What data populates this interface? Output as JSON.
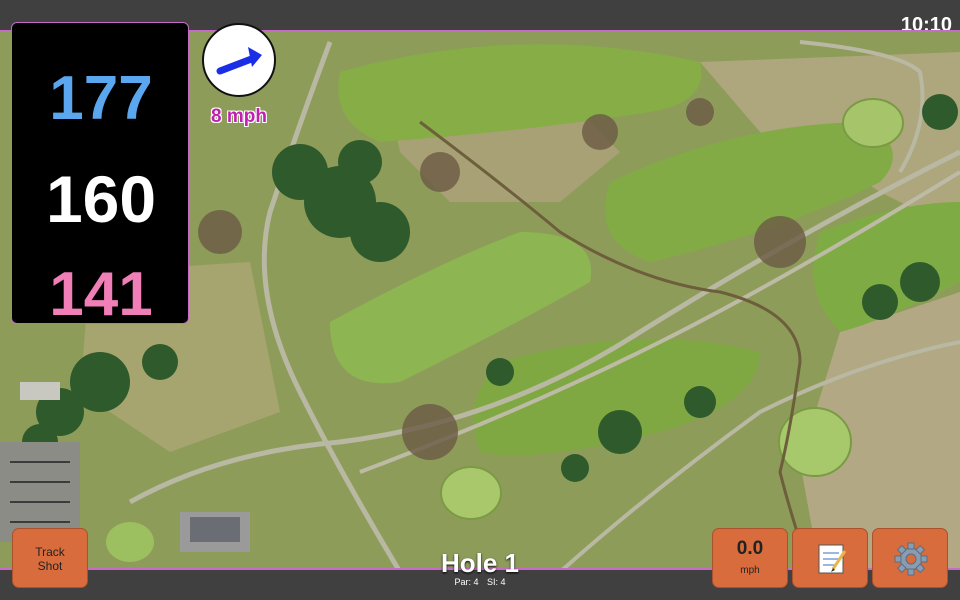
{
  "status_bar": {
    "time": "10:10"
  },
  "distances": {
    "back": "177",
    "middle": "160",
    "front": "141"
  },
  "wind": {
    "speed_label": "8 mph",
    "icon": "wind-direction-arrow-icon"
  },
  "buttons": {
    "track_shot_line1": "Track",
    "track_shot_line2": "Shot",
    "wind_value": "0.0",
    "wind_unit": "mph",
    "notes_icon": "notepad-icon",
    "settings_icon": "gear-icon"
  },
  "hole": {
    "title": "Hole 1",
    "par": "Par: 4",
    "si": "SI: 4"
  },
  "colors": {
    "back": "#5aa7ef",
    "middle": "#ffffff",
    "front": "#f07fb7",
    "button": "#d96c3c",
    "accent": "#c86ac8"
  }
}
